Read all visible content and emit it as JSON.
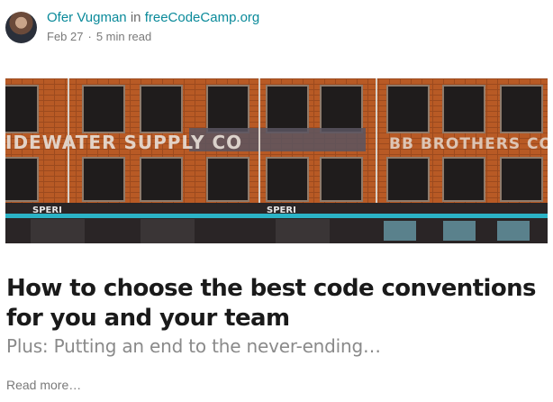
{
  "post": {
    "author": "Ofer Vugman",
    "in_word": "in",
    "publication": "freeCodeCamp.org",
    "date": "Feb 27",
    "separator": "·",
    "read_time": "5 min read",
    "title": "How to choose the best code conventions for you and your team",
    "subtitle": "Plus: Putting an end to the never-ending…",
    "read_more": "Read more…"
  },
  "hero_image": {
    "description_icon": "building-facade-image",
    "sign_left": "IDEWATER SUPPLY CO",
    "sign_right": "BB  BROTHERS CO",
    "door_label_left": "SPERI",
    "door_label_right": "SPERI"
  },
  "colors": {
    "link": "#0a8a9a",
    "title": "#1a1a1a",
    "muted": "#8a8a8a",
    "brick": "#b85a25",
    "teal_stripe": "#2bb3c6"
  }
}
